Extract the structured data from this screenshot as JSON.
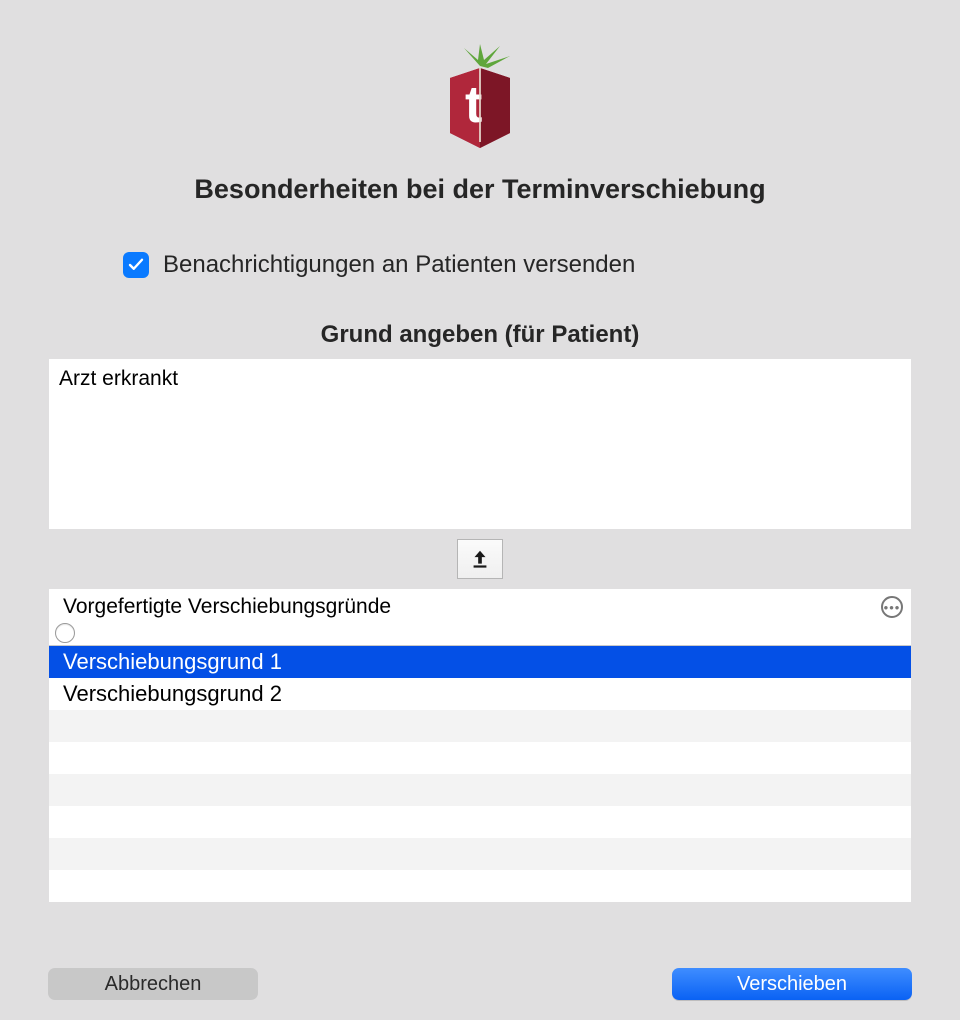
{
  "title": "Besonderheiten bei der Terminverschiebung",
  "checkbox": {
    "checked": true,
    "label": "Benachrichtigungen an Patienten versenden"
  },
  "reason_section": {
    "label": "Grund angeben (für Patient)",
    "value": "Arzt erkrankt"
  },
  "preset": {
    "header": "Vorgefertigte Verschiebungsgründe",
    "items": [
      "Verschiebungsgrund 1",
      "Verschiebungsgrund 2"
    ],
    "selected_index": 0,
    "visible_rows": 8
  },
  "buttons": {
    "cancel": "Abbrechen",
    "confirm": "Verschieben"
  },
  "colors": {
    "accent_blue": "#0a7aff",
    "selection_blue": "#0450e6",
    "primary_button": "#0a62f4"
  }
}
